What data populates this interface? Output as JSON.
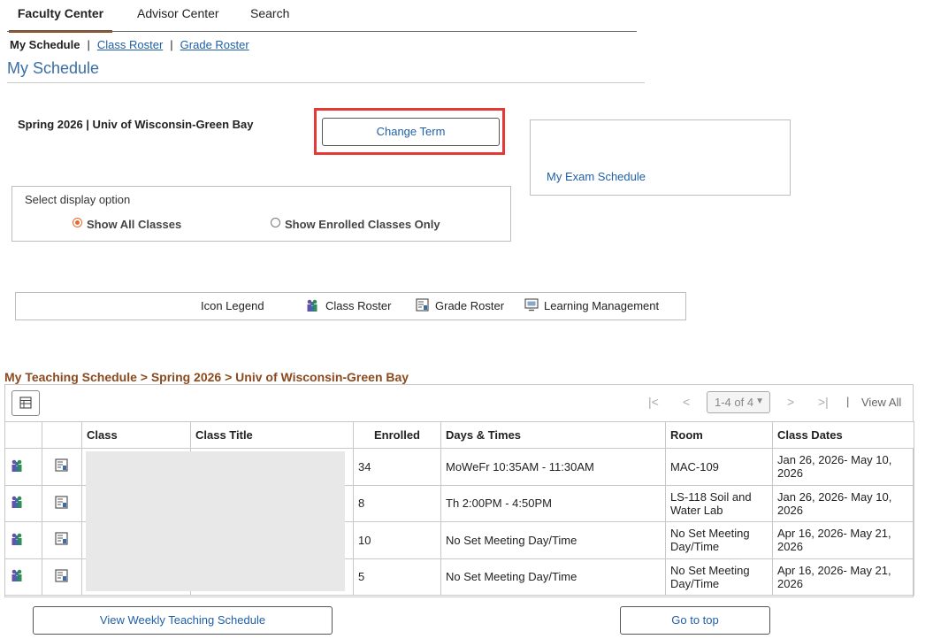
{
  "tabs": [
    {
      "label": "Faculty Center",
      "active": true
    },
    {
      "label": "Advisor Center",
      "active": false
    },
    {
      "label": "Search",
      "active": false
    }
  ],
  "subnav": {
    "current": "My Schedule",
    "links": [
      "Class Roster",
      "Grade Roster"
    ],
    "separator": "|"
  },
  "page_title": "My Schedule",
  "term": {
    "label": "Spring 2026 | Univ of Wisconsin-Green Bay",
    "change_button": "Change Term"
  },
  "exam_link": "My Exam Schedule",
  "display_options": {
    "title": "Select display option",
    "options": [
      {
        "label": "Show All Classes",
        "selected": true
      },
      {
        "label": "Show Enrolled Classes Only",
        "selected": false
      }
    ]
  },
  "legend": {
    "title": "Icon Legend",
    "items": [
      {
        "label": "Class Roster",
        "icon": "class-roster-icon"
      },
      {
        "label": "Grade Roster",
        "icon": "grade-roster-icon"
      },
      {
        "label": "Learning Management",
        "icon": "learning-management-icon"
      }
    ]
  },
  "schedule": {
    "title": "My Teaching Schedule > Spring 2026 > Univ of Wisconsin-Green Bay",
    "pager": {
      "range": "1-4 of 4",
      "view_all": "View All"
    },
    "columns": [
      "Class",
      "Class Title",
      "Enrolled",
      "Days & Times",
      "Room",
      "Class Dates"
    ],
    "rows": [
      {
        "enrolled": "34",
        "days_times": "MoWeFr 10:35AM - 11:30AM",
        "room": "MAC-109",
        "dates": "Jan 26, 2026- May 10, 2026"
      },
      {
        "enrolled": "8",
        "days_times": "Th 2:00PM - 4:50PM",
        "room": "LS-118  Soil and Water Lab",
        "dates": "Jan 26, 2026- May 10, 2026"
      },
      {
        "enrolled": "10",
        "days_times": "No Set Meeting Day/Time",
        "room": "No Set Meeting Day/Time",
        "dates": "Apr 16, 2026- May 21, 2026"
      },
      {
        "enrolled": "5",
        "days_times": "No Set Meeting Day/Time",
        "room": "No Set Meeting Day/Time",
        "dates": "Apr 16, 2026- May 21, 2026"
      }
    ]
  },
  "buttons": {
    "weekly": "View Weekly Teaching Schedule",
    "top": "Go to top"
  },
  "colors": {
    "accent": "#8a4a1e",
    "link": "#1f5fa8",
    "title": "#3a6ea5",
    "highlight": "#e53935",
    "radio": "#e8692d"
  }
}
